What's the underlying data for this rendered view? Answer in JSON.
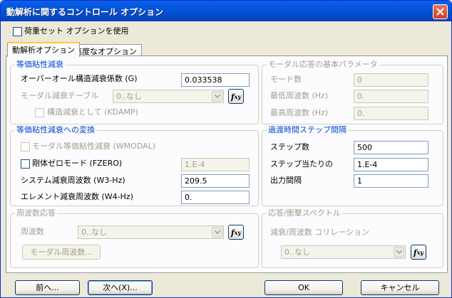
{
  "window": {
    "title": "動解析に関するコントロール オプション"
  },
  "top": {
    "load_set_option_label": "荷重セット オプションを使用"
  },
  "tabs": [
    {
      "label": "動解析オプション"
    },
    {
      "label": "高度なオプション"
    }
  ],
  "equiv_damping": {
    "title": "等価粘性減衰",
    "overall_label": "オーバーオール構造減衰係数 (G)",
    "overall_value": "0.033538",
    "modal_table_label": "モーダル減衰テーブル",
    "modal_table_value": "0..なし",
    "kdamp_label": "構造減衰として (KDAMP)"
  },
  "equiv_conversion": {
    "title": "等価粘性減衰への変換",
    "wmodal_label": "モーダル等価粘性減衰 (WMODAL)",
    "fzero_label": "剛体ゼロモード (FZERO)",
    "fzero_value": "1.E-4",
    "w3_label": "システム減衰周波数 (W3-Hz)",
    "w3_value": "209.5",
    "w4_label": "エレメント減衰周波数 (W4-Hz)",
    "w4_value": "0."
  },
  "freq_response": {
    "title": "周波数応答",
    "freq_label": "周波数",
    "freq_value": "0..なし",
    "modal_freq_button": "モーダル周波数..."
  },
  "modal_params": {
    "title": "モーダル応答の基本パラメータ",
    "mode_count_label": "モード数",
    "mode_count_value": "0",
    "min_freq_label": "最低周波数 (Hz)",
    "min_freq_value": "0.",
    "max_freq_label": "最高周波数 (Hz)",
    "max_freq_value": "0."
  },
  "transient": {
    "title": "過渡時間ステップ間隔",
    "steps_label": "ステップ数",
    "steps_value": "500",
    "per_step_label": "ステップ当たりの",
    "per_step_value": "1.E-4",
    "output_label": "出力間隔",
    "output_value": "1"
  },
  "response_spectrum": {
    "title": "応答/衝撃スペクトル",
    "corr_label": "減衰/周波数 コリレーション",
    "corr_value": "0..なし"
  },
  "fxy_label": "fxy",
  "footer": {
    "prev": "前へ...",
    "next": "次へ(X)...",
    "ok": "OK",
    "cancel": "キャンセル"
  }
}
